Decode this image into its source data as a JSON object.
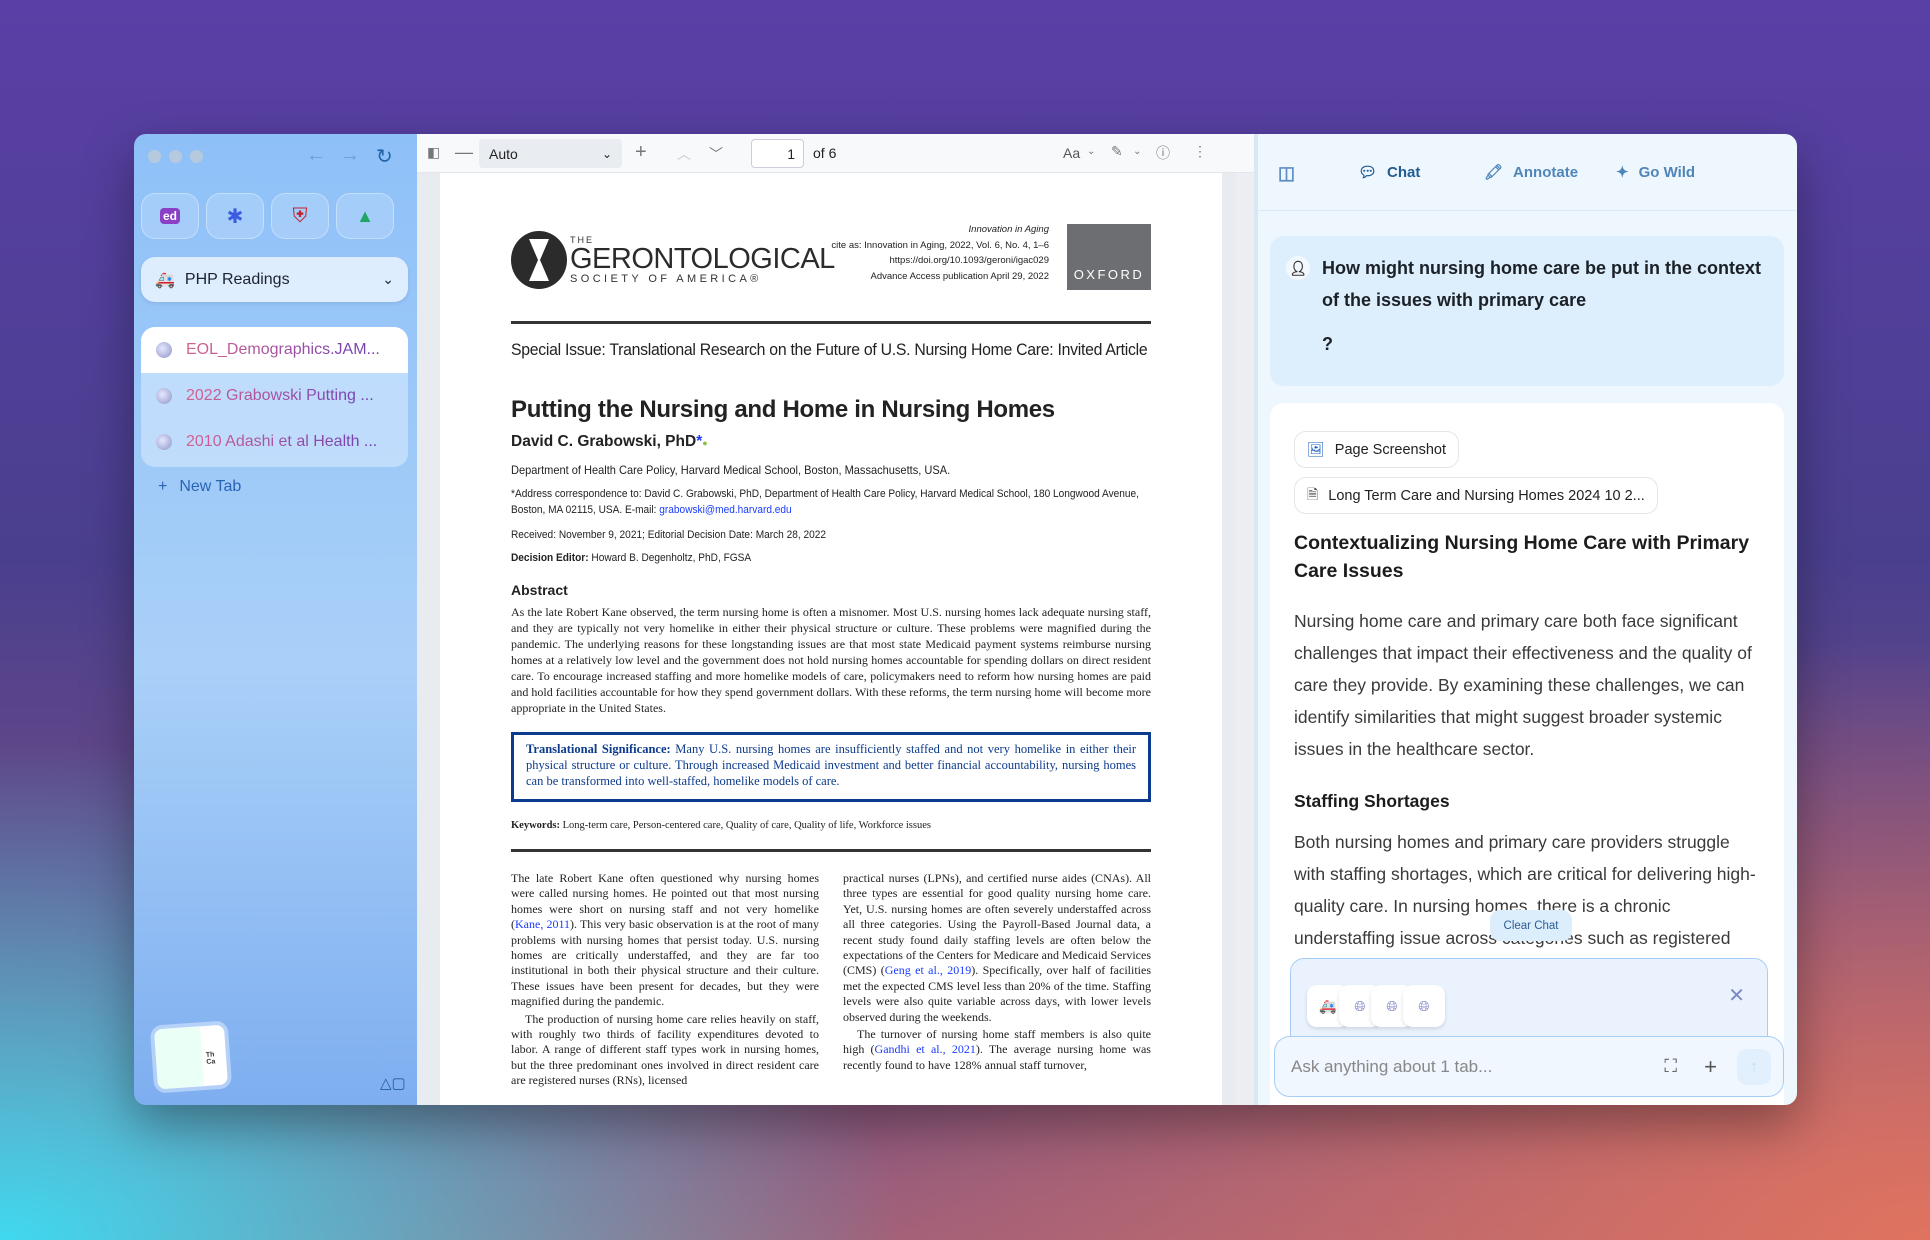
{
  "sidebar": {
    "pinned": [
      {
        "icon": "ed-icon",
        "label": "ed"
      },
      {
        "icon": "asterisk-app-icon",
        "label": "✱"
      },
      {
        "icon": "harvard-shield-icon",
        "label": "⛨"
      },
      {
        "icon": "google-drive-icon",
        "label": "▲"
      }
    ],
    "space": {
      "emoji": "🚑",
      "name": "PHP Readings"
    },
    "tabs": [
      {
        "title": "EOL_Demographics.JAM...",
        "active": true
      },
      {
        "title": "2022 Grabowski Putting ..."
      },
      {
        "title": "2010 Adashi et al Health ..."
      }
    ],
    "new_tab": "New Tab",
    "thumb_text": "Th Ca"
  },
  "pdf_toolbar": {
    "zoom": "Auto",
    "page": "1",
    "of": "of 6",
    "font_btn": "Aa"
  },
  "pdf": {
    "logo": {
      "the": "THE",
      "name": "GERONTOLOGICAL",
      "society": "SOCIETY OF AMERICA®"
    },
    "cite": [
      "Innovation in Aging",
      "cite as: Innovation in Aging, 2022, Vol. 6, No. 4, 1–6",
      "https://doi.org/10.1093/geroni/igac029",
      "Advance Access publication April 29, 2022"
    ],
    "publisher": "OXFORD",
    "special_issue": "Special Issue: Translational Research on the Future of U.S. Nursing Home Care: Invited Article",
    "title": "Putting the Nursing and Home in Nursing Homes",
    "author": "David C. Grabowski, PhD",
    "author_mark": "*",
    "affiliation": "Department of Health Care Policy, Harvard Medical School, Boston, Massachusetts, USA.",
    "address": "*Address correspondence to: David C. Grabowski, PhD, Department of Health Care Policy, Harvard Medical School, 180 Longwood Avenue, Boston, MA 02115, USA. E-mail: ",
    "email": "grabowski@med.harvard.edu",
    "received": "Received: November 9, 2021; Editorial Decision Date: March 28, 2022",
    "editor_label": "Decision Editor:",
    "editor": " Howard B. Degenholtz, PhD, FGSA",
    "abstract_heading": "Abstract",
    "abstract": "As the late Robert Kane observed, the term nursing home is often a misnomer. Most U.S. nursing homes lack adequate nursing staff, and they are typically not very homelike in either their physical structure or culture. These problems were magnified during the pandemic. The underlying reasons for these longstanding issues are that most state Medicaid payment systems reimburse nursing homes at a relatively low level and the government does not hold nursing homes accountable for spending dollars on direct resident care. To encourage increased staffing and more homelike models of care, policymakers need to reform how nursing homes are paid and hold facilities accountable for how they spend government dollars. With these reforms, the term nursing home will become more appropriate in the United States.",
    "ts_label": "Translational Significance:",
    "ts_text": " Many U.S. nursing homes are insufficiently staffed and not very homelike in either their physical structure or culture. Through increased Medicaid investment and better financial accountability, nursing homes can be transformed into well-staffed, homelike models of care.",
    "keywords_label": "Keywords:",
    "keywords": "  Long-term care, Person-centered care, Quality of care, Quality of life, Workforce issues",
    "left_p1": [
      "The late Robert Kane often questioned why nursing homes were called nursing homes. He pointed out that most nursing homes were short on nursing staff and not very homelike (",
      "Kane, 2011",
      "). This very basic observation is at the root of many problems with nursing homes that persist today. U.S. nursing homes are critically understaffed, and they are far too institutional in both their physical structure and their culture. These issues have been present for decades, but they were magnified during the pandemic."
    ],
    "left_p2": "The production of nursing home care relies heavily on staff, with roughly two thirds of facility expenditures devoted to labor. A range of different staff types work in nursing homes, but the three predominant ones involved in direct resident care are registered nurses (RNs), licensed",
    "right_p1": [
      "practical nurses (LPNs), and certified nurse aides (CNAs). All three types are essential for good quality nursing home care. Yet, U.S. nursing homes are often severely understaffed across all three categories. Using the Payroll-Based Journal data, a recent study found daily staffing levels are often below the expectations of the Centers for Medicare and Medicaid Services (CMS) (",
      "Geng et al., 2019",
      "). Specifically, over half of facilities met the expected CMS level less than 20% of the time. Staffing levels were also quite variable across days, with lower levels observed during the weekends."
    ],
    "right_p2": [
      "The turnover of nursing home staff members is also quite high (",
      "Gandhi et al., 2021",
      "). The average nursing home was recently found to have 128% annual staff turnover,"
    ]
  },
  "chat": {
    "tabs": [
      {
        "label": "Chat",
        "icon": "chat-bubble-icon",
        "active": true
      },
      {
        "label": "Annotate",
        "icon": "highlighter-icon"
      },
      {
        "label": "Go Wild",
        "icon": "sparkles-icon"
      }
    ],
    "question": "How might nursing home care be put in the context of the issues with primary care",
    "question_tail": "?",
    "chips": [
      "Page Screenshot",
      "Long Term Care and Nursing Homes 2024 10 2..."
    ],
    "answer_title": "Contextualizing Nursing Home Care with Primary Care Issues",
    "answer_p1": "Nursing home care and primary care both face significant challenges that impact their effectiveness and the quality of care they provide. By examining these challenges, we can identify similarities that might suggest broader systemic issues in the healthcare sector.",
    "section_heading": "Staffing Shortages",
    "answer_p2": "Both nursing homes and primary care providers struggle with staffing shortages, which are critical for delivering high-quality care. In nursing homes, there is a chronic understaffing issue across categories such as registered",
    "clear_chat": "Clear Chat",
    "input_placeholder": "Ask anything about 1 tab..."
  },
  "colors": {
    "accent": "#2a64b5",
    "significance_blue": "#0c3a8c",
    "link": "#1a3cff"
  }
}
